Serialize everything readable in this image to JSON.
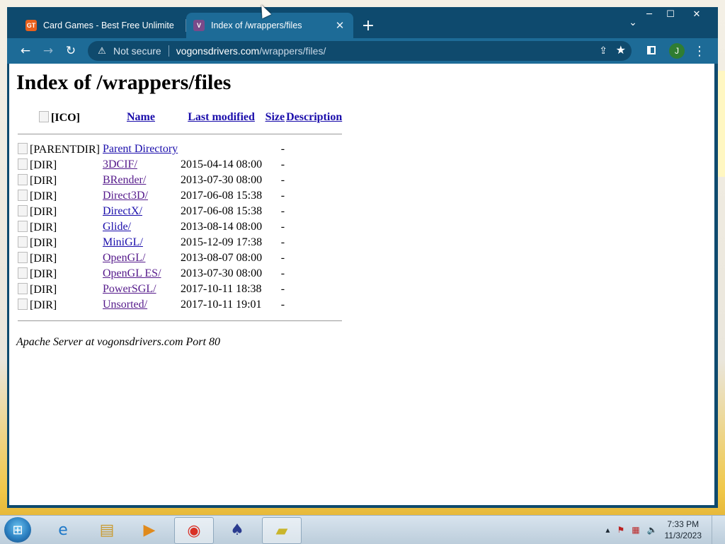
{
  "browser": {
    "tabs": [
      {
        "favicon": "GT",
        "title": "Card Games - Best Free Unlimite",
        "active": false
      },
      {
        "favicon": "V",
        "title": "Index of /wrappers/files",
        "active": true
      }
    ],
    "new_tab_glyph": "+",
    "tab_list_glyph": "⌄",
    "close_glyph": "✕",
    "window_controls": {
      "minimize": "─",
      "maximize": "☐",
      "close": "✕"
    },
    "toolbar": {
      "back": "←",
      "forward": "→",
      "reload": "↻"
    },
    "omnibox": {
      "warning_icon": "⚠",
      "security_text": "Not secure",
      "host": "vogonsdrivers.com",
      "path": "/wrappers/files/"
    },
    "profile_initial": "J",
    "menu_glyph": "⋮"
  },
  "page": {
    "heading": "Index of /wrappers/files",
    "columns": {
      "icon": "[ICO]",
      "name": "Name",
      "modified": "Last modified",
      "size": "Size",
      "description": "Description"
    },
    "parent": {
      "icon_alt": "[PARENTDIR]",
      "name": "Parent Directory",
      "size": "-"
    },
    "rows": [
      {
        "icon_alt": "[DIR]",
        "name": "3DCIF/",
        "modified": "2015-04-14 08:00",
        "size": "-"
      },
      {
        "icon_alt": "[DIR]",
        "name": "BRender/",
        "modified": "2013-07-30 08:00",
        "size": "-"
      },
      {
        "icon_alt": "[DIR]",
        "name": "Direct3D/",
        "modified": "2017-06-08 15:38",
        "size": "-"
      },
      {
        "icon_alt": "[DIR]",
        "name": "DirectX/",
        "modified": "2017-06-08 15:38",
        "size": "-"
      },
      {
        "icon_alt": "[DIR]",
        "name": "Glide/",
        "modified": "2013-08-14 08:00",
        "size": "-"
      },
      {
        "icon_alt": "[DIR]",
        "name": "MiniGL/",
        "modified": "2015-12-09 17:38",
        "size": "-"
      },
      {
        "icon_alt": "[DIR]",
        "name": "OpenGL/",
        "modified": "2013-08-07 08:00",
        "size": "-"
      },
      {
        "icon_alt": "[DIR]",
        "name": "OpenGL ES/",
        "modified": "2013-07-30 08:00",
        "size": "-"
      },
      {
        "icon_alt": "[DIR]",
        "name": "PowerSGL/",
        "modified": "2017-10-11 18:38",
        "size": "-"
      },
      {
        "icon_alt": "[DIR]",
        "name": "Unsorted/",
        "modified": "2017-10-11 19:01",
        "size": "-"
      }
    ],
    "footer": "Apache Server at vogonsdrivers.com Port 80"
  },
  "taskbar": {
    "apps": [
      "internet-explorer-icon",
      "file-explorer-icon",
      "media-player-icon",
      "chrome-icon",
      "solitaire-icon",
      "sticky-notes-icon"
    ],
    "clock_time": "7:33 PM",
    "clock_date": "11/3/2023"
  }
}
